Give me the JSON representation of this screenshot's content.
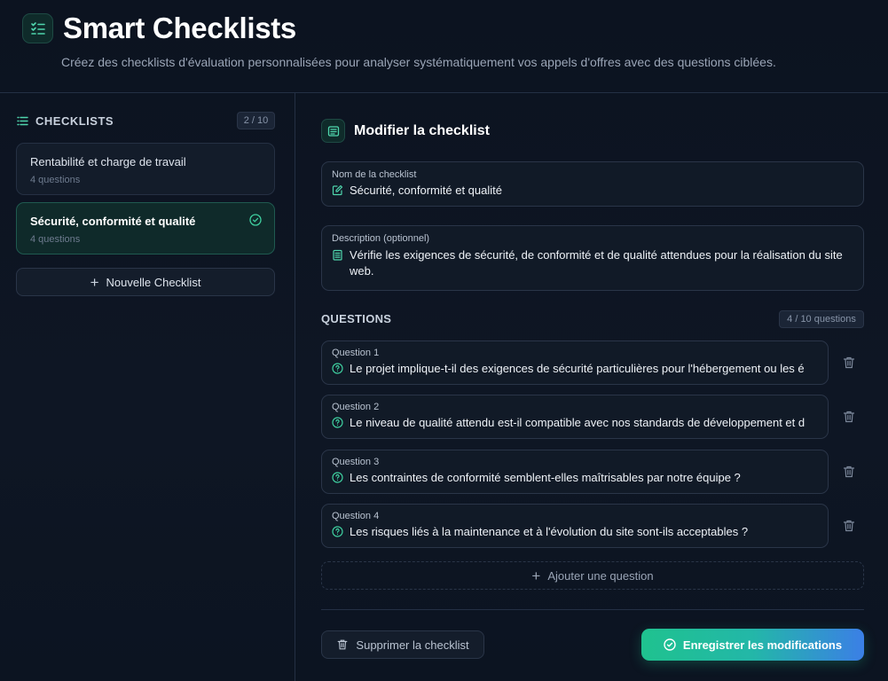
{
  "header": {
    "title": "Smart Checklists",
    "subtitle": "Créez des checklists d'évaluation personnalisées pour analyser systématiquement vos appels d'offres avec des questions ciblées."
  },
  "sidebar": {
    "title": "CHECKLISTS",
    "count": "2 / 10",
    "items": [
      {
        "name": "Rentabilité et charge de travail",
        "sub": "4 questions",
        "active": false
      },
      {
        "name": "Sécurité, conformité et qualité",
        "sub": "4 questions",
        "active": true
      }
    ],
    "new_label": "Nouvelle Checklist"
  },
  "editor": {
    "title": "Modifier la checklist",
    "name_label": "Nom de la checklist",
    "name_value": "Sécurité, conformité et qualité",
    "desc_label": "Description (optionnel)",
    "desc_value": "Vérifie les exigences de sécurité, de conformité et de qualité attendues pour la réalisation du site web.",
    "questions_title": "QUESTIONS",
    "questions_count": "4 / 10 questions",
    "questions": [
      {
        "label": "Question 1",
        "text": "Le projet implique-t-il des exigences de sécurité particulières pour l'hébergement ou les é"
      },
      {
        "label": "Question 2",
        "text": "Le niveau de qualité attendu est-il compatible avec nos standards de développement et d"
      },
      {
        "label": "Question 3",
        "text": "Les contraintes de conformité semblent-elles maîtrisables par notre équipe ?"
      },
      {
        "label": "Question 4",
        "text": "Les risques liés à la maintenance et à l'évolution du site sont-ils acceptables ?"
      }
    ],
    "add_question": "Ajouter une question",
    "delete_label": "Supprimer la checklist",
    "save_label": "Enregistrer les modifications"
  },
  "colors": {
    "accent": "#1fc28f",
    "background": "#0c1320",
    "panel": "#111a27"
  }
}
